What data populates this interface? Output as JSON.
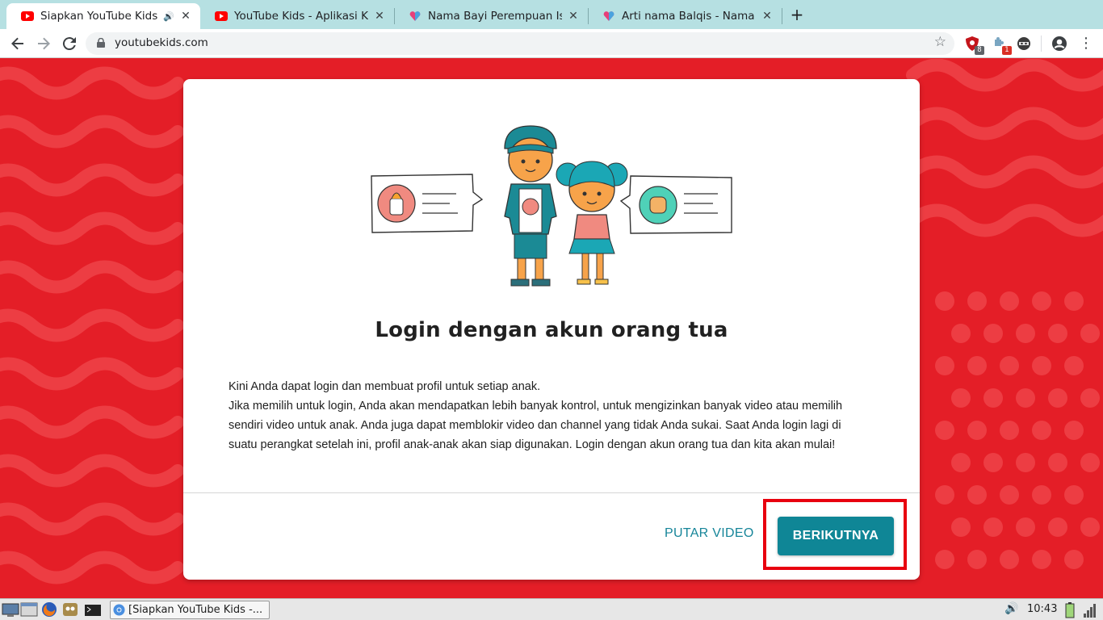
{
  "browser": {
    "tabs": [
      {
        "title": "Siapkan YouTube Kids",
        "active": true,
        "favicon": "youtube-icon"
      },
      {
        "title": "YouTube Kids - Aplikasi Kh",
        "active": false,
        "favicon": "youtube-icon"
      },
      {
        "title": "Nama Bayi Perempuan Isl",
        "active": false,
        "favicon": "heart-icon"
      },
      {
        "title": "Arti nama Balqis - Nama B",
        "active": false,
        "favicon": "heart-icon"
      }
    ],
    "new_tab_label": "+",
    "url": "youtubekids.com",
    "extensions": [
      {
        "name": "ublock-icon",
        "badge": "8",
        "badge_color": "#5f6368"
      },
      {
        "name": "puzzle-extension-icon",
        "badge": "1",
        "badge_color": "#d93025"
      },
      {
        "name": "ninja-extension-icon",
        "badge": ""
      }
    ]
  },
  "page": {
    "heading": "Login dengan akun orang tua",
    "paragraphs": [
      "Kini Anda dapat login dan membuat profil untuk setiap anak.",
      "Jika memilih untuk login, Anda akan mendapatkan lebih banyak kontrol, untuk mengizinkan banyak video atau memilih sendiri video untuk anak. Anda juga dapat memblokir video dan channel yang tidak Anda sukai. Saat Anda login lagi di suatu perangkat setelah ini, profil anak-anak akan siap digunakan. Login dengan akun orang tua dan kita akan mulai!"
    ],
    "secondary_button": "PUTAR VIDEO",
    "primary_button": "BERIKUTNYA",
    "colors": {
      "background": "#e41e27",
      "accent": "#0f8696",
      "highlight": "#e8000f"
    }
  },
  "taskbar": {
    "task_label": "[Siapkan YouTube Kids -...",
    "clock": "10:43"
  }
}
